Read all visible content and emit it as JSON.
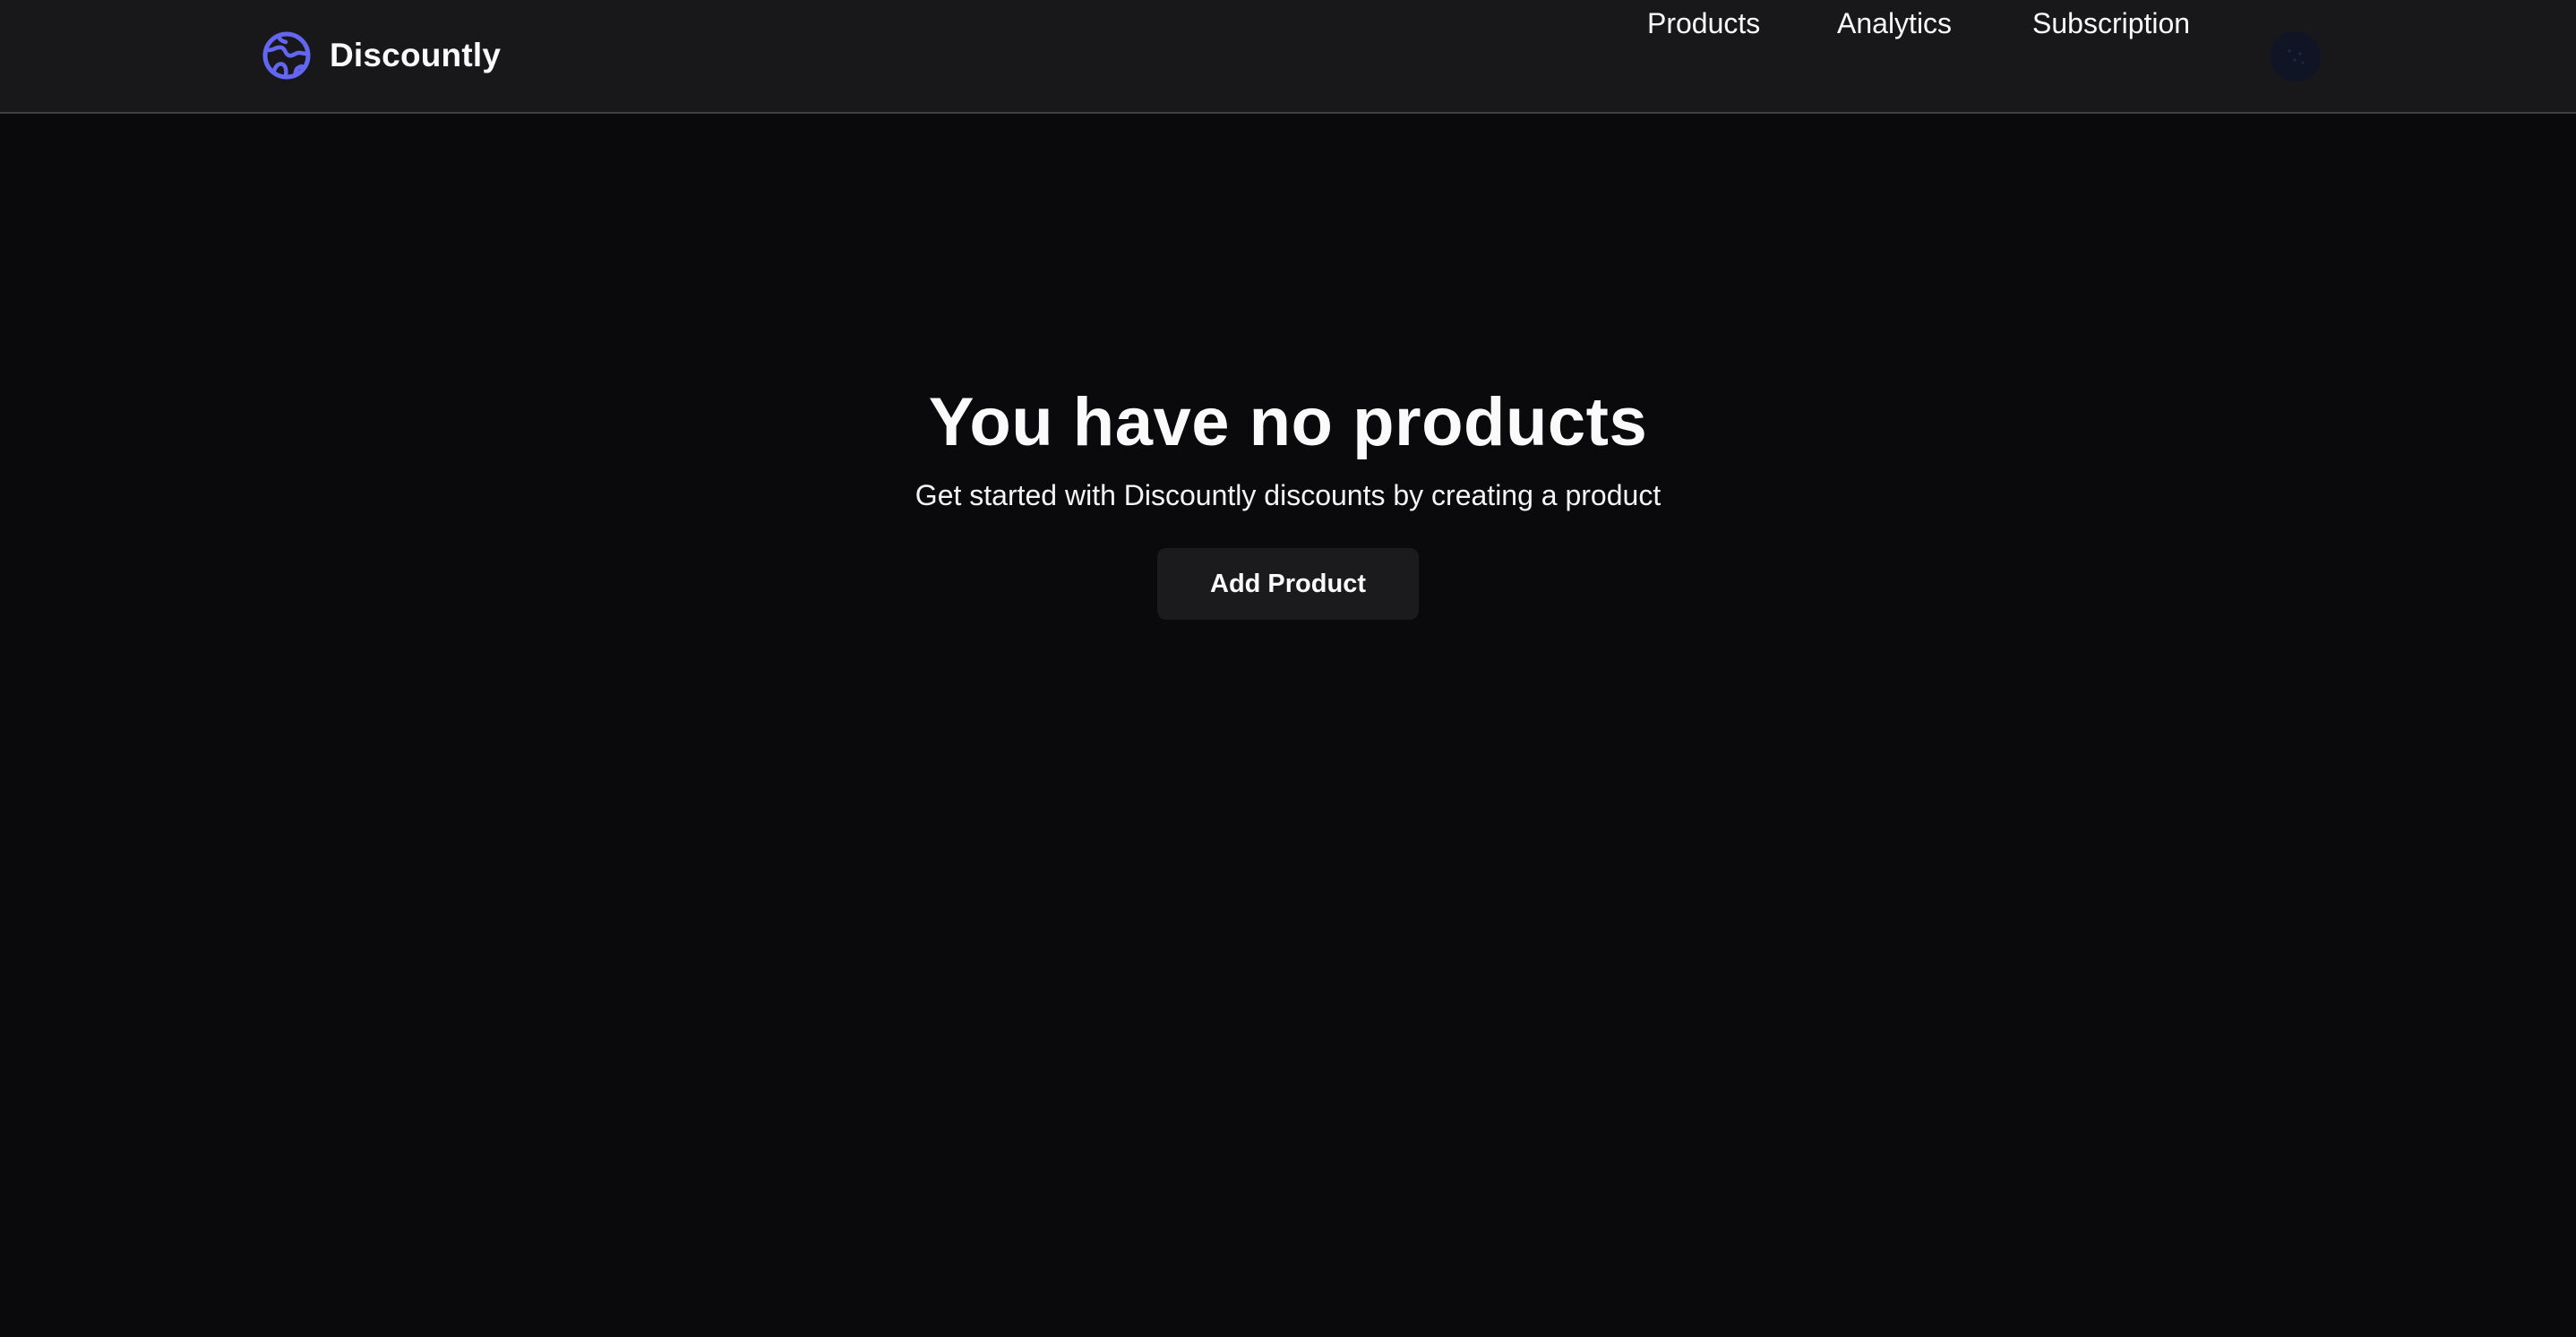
{
  "brand": {
    "name": "Discountly",
    "logo_icon": "globe-icon",
    "accent_color": "#6366f1"
  },
  "nav": {
    "links": [
      {
        "label": "Products"
      },
      {
        "label": "Analytics"
      },
      {
        "label": "Subscription"
      }
    ],
    "avatar_icon": "user-avatar"
  },
  "empty_state": {
    "title": "You have no products",
    "subtitle": "Get started with Discountly discounts by creating a product",
    "button_label": "Add Product"
  }
}
